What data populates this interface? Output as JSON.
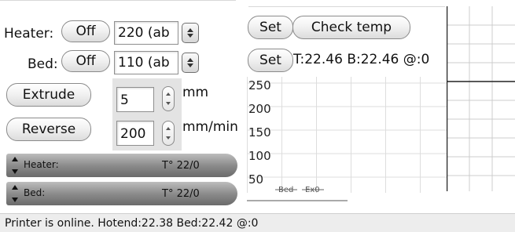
{
  "controls": {
    "heater_label": "Heater:",
    "heater_toggle": "Off",
    "heater_value": "220 (ab",
    "bed_label": "Bed:",
    "bed_toggle": "Off",
    "bed_value": "110 (ab",
    "set_button_1": "Set",
    "check_temp_button": "Check temp",
    "set_button_2": "Set",
    "temp_readout": "T:22.46 B:22.46 @:0",
    "extrude_button": "Extrude",
    "reverse_button": "Reverse",
    "extrude_amount": "5",
    "extrude_unit": "mm",
    "feedrate": "200",
    "feedrate_unit": "mm/min"
  },
  "temp_bars": [
    {
      "name": "Heater:",
      "value": "T° 22/0"
    },
    {
      "name": "Bed:",
      "value": "T° 22/0"
    }
  ],
  "chart_data": {
    "type": "line",
    "ytick_labels": [
      "250",
      "200",
      "150",
      "100",
      "50"
    ],
    "series": [
      {
        "name": "Bed",
        "values": []
      },
      {
        "name": "Ex0",
        "values": []
      }
    ],
    "grid": true
  },
  "status": {
    "text": "Printer is online. Hotend:22.38 Bed:22.42 @:0"
  }
}
